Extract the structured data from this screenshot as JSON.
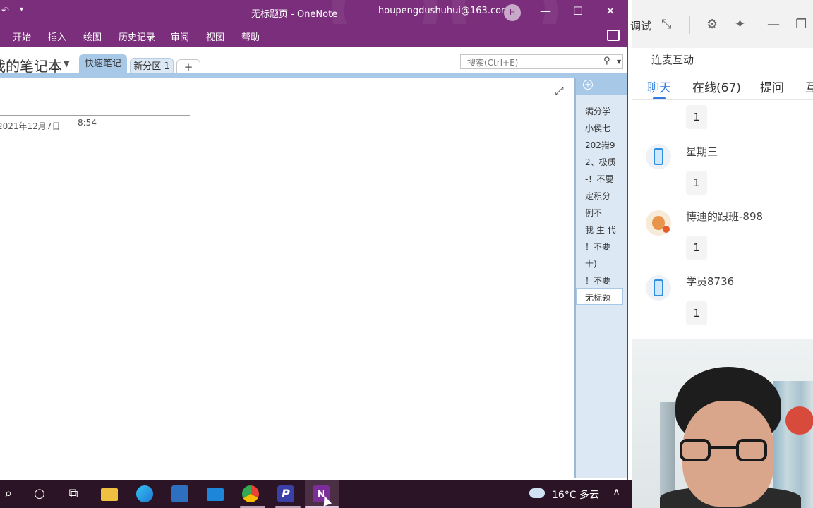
{
  "onenote": {
    "qat_undo": "↶",
    "qat_dropdown": "▾",
    "title": "无标题页  -  OneNote",
    "account": "houpengdushuhui@163.com",
    "avatar_initial": "H",
    "window_controls": {
      "minimize": "—",
      "maximize": "☐",
      "close": "✕"
    },
    "menu": [
      "开始",
      "插入",
      "绘图",
      "历史记录",
      "审阅",
      "视图",
      "帮助"
    ],
    "notebook_name": "我的笔记本",
    "notebook_dropdown": "▼",
    "sections": [
      "快速笔记",
      "新分区 1"
    ],
    "add_section": "+",
    "search_placeholder": "搜索(Ctrl+E)",
    "page": {
      "date": "2021年12月7日",
      "time": "8:54",
      "expand": "⤢"
    },
    "add_page": "+",
    "pages": [
      "满分学",
      "小侯七",
      "202㟛9",
      "2、极质",
      "-！不要",
      "定积分",
      "例不",
      "我 生 代",
      "！不要",
      "十)",
      "！不要"
    ],
    "selected_page": "无标题",
    "colors": {
      "brand": "#7b2e7b",
      "section_tab": "#a8c8e8",
      "page_list": "#dce9f5"
    }
  },
  "live": {
    "top_text": "调试",
    "icons": [
      "collapse-icon",
      "gear-icon",
      "pin-icon",
      "minimize-icon",
      "restore-icon"
    ],
    "lianmai": "连麦互动",
    "tabs": [
      "聊天",
      "在线(67)",
      "提问",
      "互"
    ],
    "messages": [
      {
        "name": "",
        "text": "1",
        "avatar": "phone-icon"
      },
      {
        "name": "星期三",
        "text": "1",
        "avatar": "phone-icon"
      },
      {
        "name": "博迪的跟班-898",
        "text": "1",
        "avatar": "fox-avatar"
      },
      {
        "name": "学员8736",
        "text": "1",
        "avatar": "phone-icon"
      }
    ],
    "accent": "#2f7be0"
  },
  "taskbar": {
    "search": "⌕",
    "cortana": "○",
    "taskview": "⧉",
    "apps": [
      "file-explorer-icon",
      "edge-icon",
      "store-icon",
      "mail-icon",
      "chrome-icon",
      "p-app-icon",
      "onenote-icon"
    ],
    "weather": "16°C  多云",
    "tray_chevron": "∧"
  }
}
